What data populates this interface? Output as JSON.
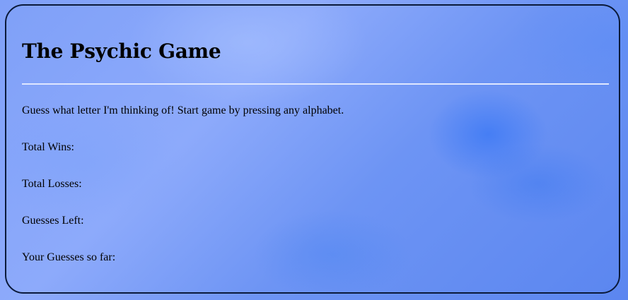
{
  "game": {
    "title": "The Psychic Game",
    "intro": "Guess what letter I'm thinking of! Start game by pressing any alphabet.",
    "stats": {
      "wins_label": "Total Wins:",
      "wins_value": "",
      "losses_label": "Total Losses:",
      "losses_value": "",
      "guesses_left_label": "Guesses Left:",
      "guesses_left_value": "",
      "guesses_so_far_label": "Your Guesses so far:",
      "guesses_so_far_value": ""
    }
  },
  "colors": {
    "background": "#7fa0f8",
    "border": "#0b1a3a",
    "divider": "#dfe7ff",
    "text": "#000000"
  }
}
